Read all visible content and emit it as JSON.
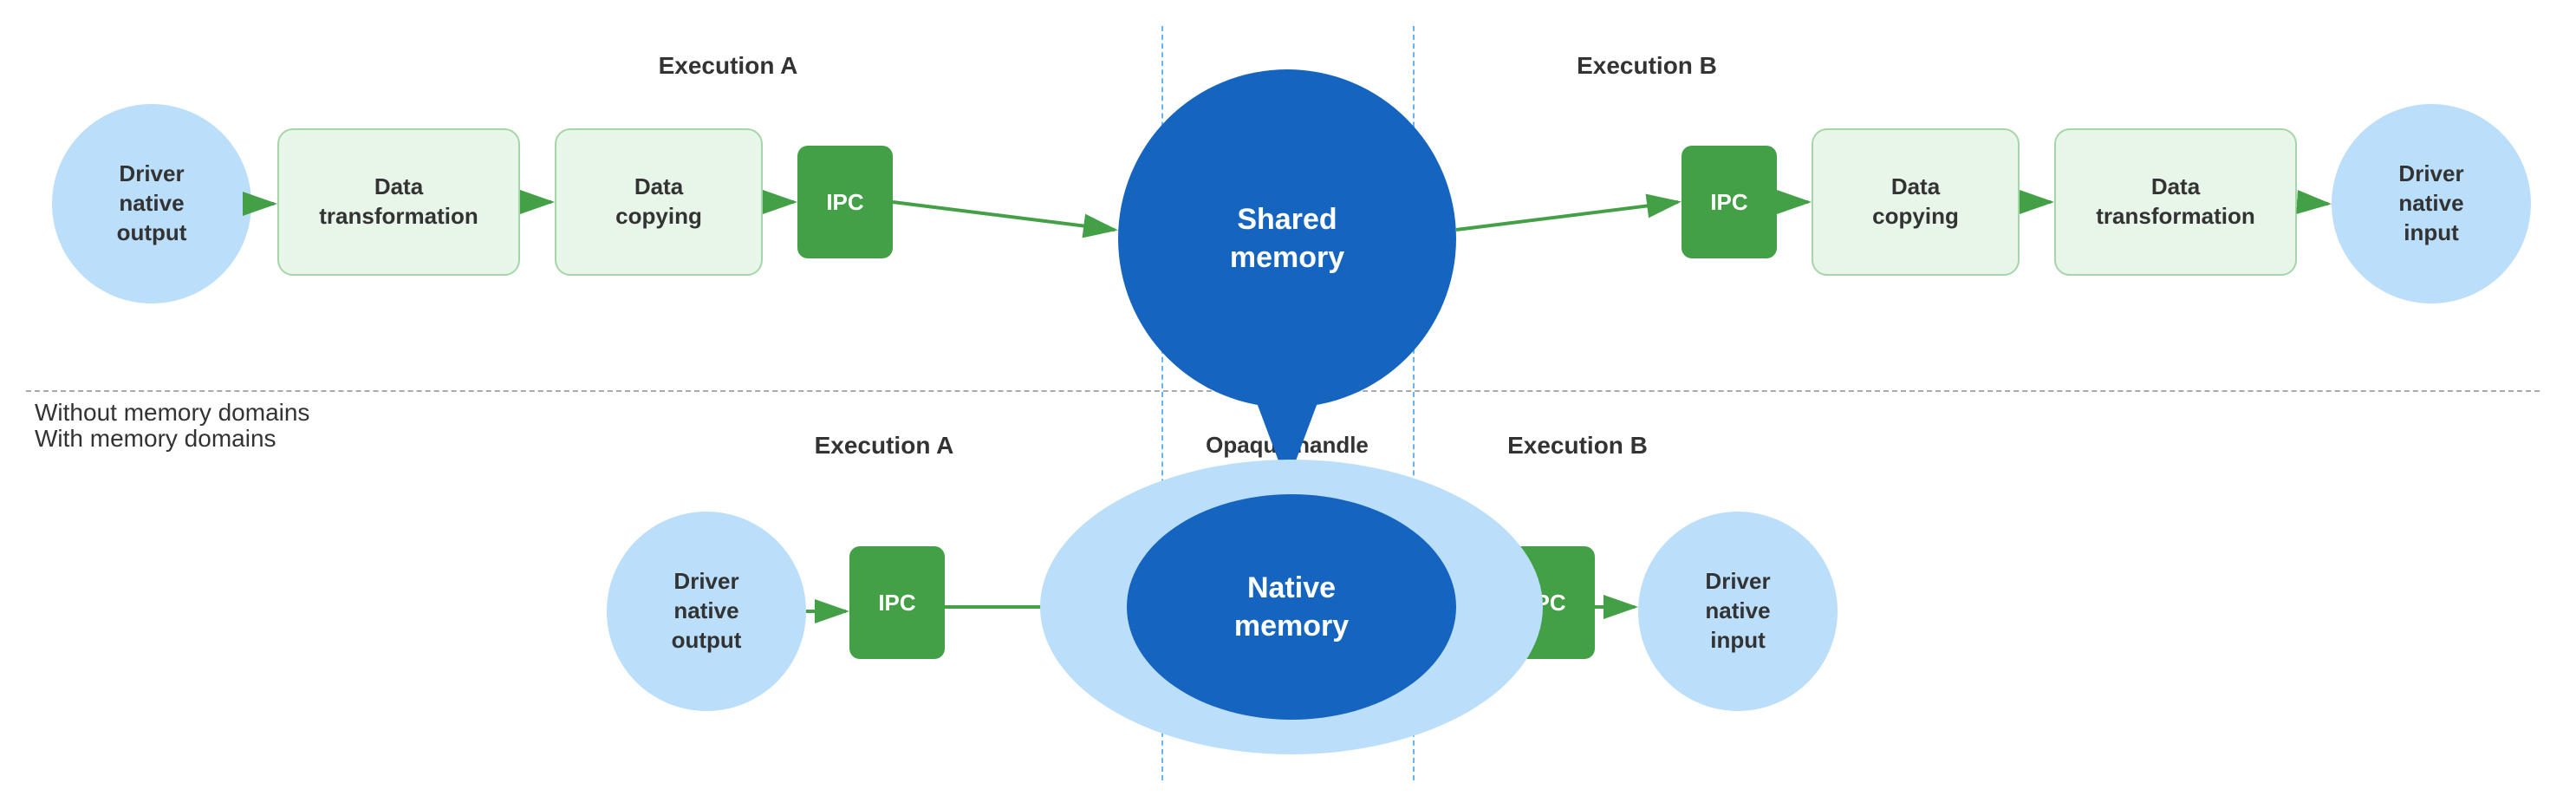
{
  "sections": {
    "without_label": "Without memory domains",
    "with_label": "With memory domains"
  },
  "top_row": {
    "exec_a_label": "Execution A",
    "exec_b_label": "Execution B",
    "nodes": [
      {
        "id": "driver_native_output_top",
        "text": "Driver\nnative\noutput",
        "type": "circle"
      },
      {
        "id": "data_transform_a",
        "text": "Data\ntransformation",
        "type": "rect"
      },
      {
        "id": "data_copy_a",
        "text": "Data\ncopying",
        "type": "rect"
      },
      {
        "id": "ipc_a",
        "text": "IPC",
        "type": "ipc"
      },
      {
        "id": "shared_memory",
        "text": "Shared\nmemory",
        "type": "shared"
      },
      {
        "id": "ipc_b",
        "text": "IPC",
        "type": "ipc"
      },
      {
        "id": "data_copy_b",
        "text": "Data\ncopying",
        "type": "rect"
      },
      {
        "id": "data_transform_b",
        "text": "Data\ntransformation",
        "type": "rect"
      },
      {
        "id": "driver_native_input_top",
        "text": "Driver\nnative\ninput",
        "type": "circle"
      }
    ]
  },
  "bottom_row": {
    "exec_a_label": "Execution A",
    "exec_b_label": "Execution B",
    "opaque_label": "Opaque handle",
    "nodes": [
      {
        "id": "driver_native_output_bot",
        "text": "Driver\nnative\noutput",
        "type": "circle"
      },
      {
        "id": "ipc_c",
        "text": "IPC",
        "type": "ipc"
      },
      {
        "id": "native_memory",
        "text": "Native\nmemory",
        "type": "native"
      },
      {
        "id": "ipc_d",
        "text": "IPC",
        "type": "ipc"
      },
      {
        "id": "driver_native_input_bot",
        "text": "Driver\nnative\ninput",
        "type": "circle"
      }
    ]
  }
}
